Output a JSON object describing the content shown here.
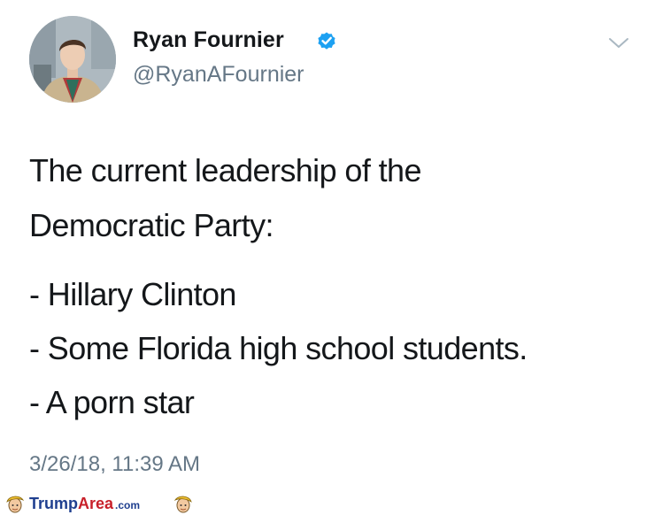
{
  "author": {
    "name": "Ryan Fournier",
    "handle": "@RyanAFournier",
    "verified": true
  },
  "tweet": {
    "lines": [
      "The current leadership of the",
      "Democratic Party:",
      "- Hillary Clinton",
      "- Some Florida high school students.",
      "- A porn star"
    ],
    "timestamp": "3/26/18, 11:39 AM"
  },
  "watermark": {
    "part1": "Trump",
    "part2": "Area",
    "part3": ".com"
  },
  "colors": {
    "verified_blue": "#1da1f2",
    "secondary_text": "#657786",
    "primary_text": "#14171a",
    "watermark_blue": "#1f3f8f",
    "watermark_red": "#c8202a"
  },
  "icons": [
    "avatar",
    "verified-badge-icon",
    "chevron-down-icon",
    "trump-caricature-icon"
  ]
}
